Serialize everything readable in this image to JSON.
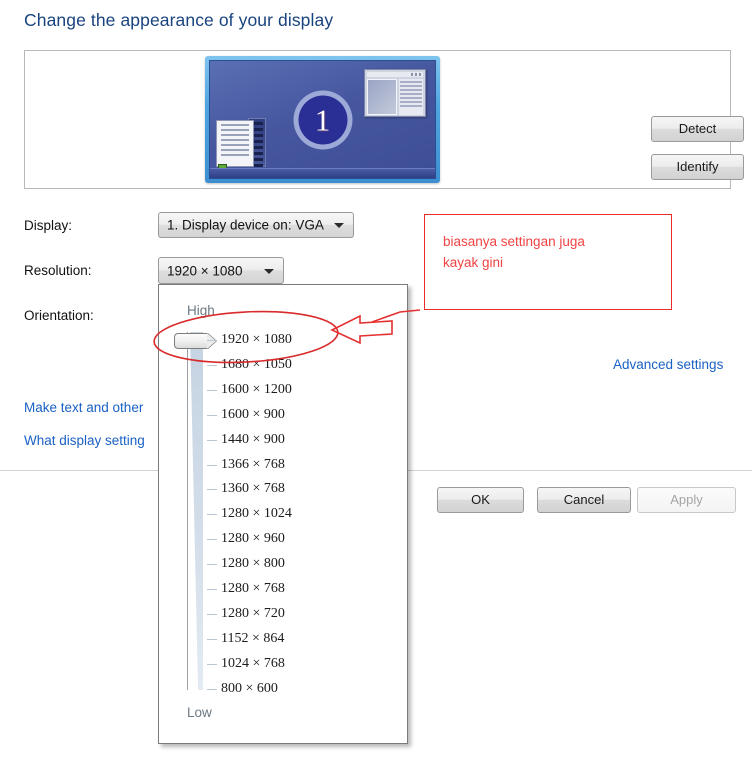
{
  "page": {
    "title": "Change the appearance of your display"
  },
  "preview": {
    "display_number": "1",
    "detect_label": "Detect",
    "identify_label": "Identify"
  },
  "form": {
    "display_label": "Display:",
    "display_value": "1. Display device on: VGA",
    "resolution_label": "Resolution:",
    "resolution_value": "1920 × 1080",
    "orientation_label": "Orientation:"
  },
  "links": {
    "advanced_settings": "Advanced settings",
    "make_text": "Make text and other",
    "what_display": "What display setting"
  },
  "buttons": {
    "ok": "OK",
    "cancel": "Cancel",
    "apply": "Apply",
    "apply_disabled": true
  },
  "dropdown": {
    "high_label": "High",
    "low_label": "Low",
    "selected_index": 0,
    "options": [
      "1920 × 1080",
      "1680 × 1050",
      "1600 × 1200",
      "1600 × 900",
      "1440 × 900",
      "1366 × 768",
      "1360 × 768",
      "1280 × 1024",
      "1280 × 960",
      "1280 × 800",
      "1280 × 768",
      "1280 × 720",
      "1152 × 864",
      "1024 × 768",
      "800 × 600"
    ]
  },
  "annotation": {
    "text": "biasanya settingan juga\nkayak gini",
    "color": "#f04343"
  },
  "colors": {
    "title_blue": "#19437e",
    "link_blue": "#1a61c4",
    "annotation_red": "#ec2c2c",
    "badge_blue": "#2a2f96"
  }
}
